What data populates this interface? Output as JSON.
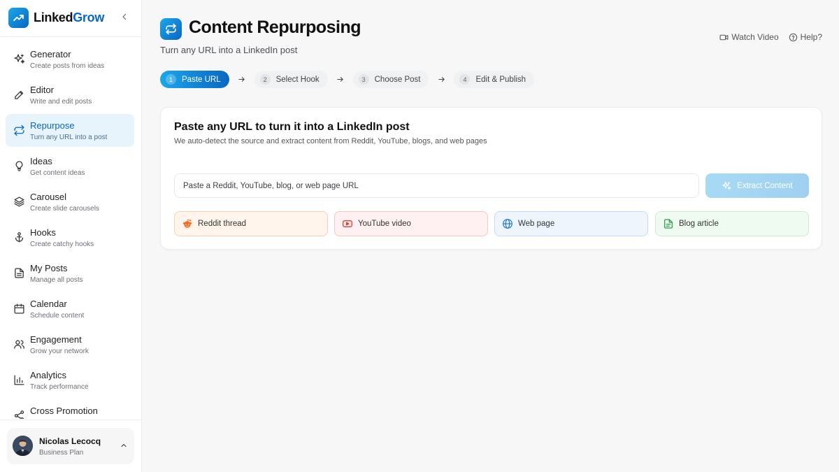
{
  "brand": {
    "name_part1": "Linked",
    "name_part2": "Grow",
    "logo_icon": "trending-up-icon"
  },
  "sidebar": {
    "items": [
      {
        "label": "Generator",
        "sub": "Create posts from ideas",
        "icon": "sparkles-icon",
        "active": false
      },
      {
        "label": "Editor",
        "sub": "Write and edit posts",
        "icon": "pencil-icon",
        "active": false
      },
      {
        "label": "Repurpose",
        "sub": "Turn any URL into a post",
        "icon": "repeat-icon",
        "active": true
      },
      {
        "label": "Ideas",
        "sub": "Get content ideas",
        "icon": "lightbulb-icon",
        "active": false
      },
      {
        "label": "Carousel",
        "sub": "Create slide carousels",
        "icon": "layers-icon",
        "active": false
      },
      {
        "label": "Hooks",
        "sub": "Create catchy hooks",
        "icon": "anchor-icon",
        "active": false
      },
      {
        "label": "My Posts",
        "sub": "Manage all posts",
        "icon": "file-text-icon",
        "active": false
      },
      {
        "label": "Calendar",
        "sub": "Schedule content",
        "icon": "calendar-icon",
        "active": false
      },
      {
        "label": "Engagement",
        "sub": "Grow your network",
        "icon": "users-icon",
        "active": false
      },
      {
        "label": "Analytics",
        "sub": "Track performance",
        "icon": "bar-chart-icon",
        "active": false
      },
      {
        "label": "Cross Promotion",
        "sub": "",
        "icon": "share-icon",
        "active": false
      }
    ]
  },
  "user": {
    "name": "Nicolas Lecocq",
    "plan": "Business Plan"
  },
  "page": {
    "title": "Content Repurposing",
    "subtitle": "Turn any URL into a LinkedIn post"
  },
  "top_actions": {
    "watch_video": "Watch Video",
    "help": "Help?"
  },
  "steps": [
    {
      "num": "1",
      "label": "Paste URL",
      "active": true
    },
    {
      "num": "2",
      "label": "Select Hook",
      "active": false
    },
    {
      "num": "3",
      "label": "Choose Post",
      "active": false
    },
    {
      "num": "4",
      "label": "Edit & Publish",
      "active": false
    }
  ],
  "card": {
    "title": "Paste any URL to turn it into a LinkedIn post",
    "description": "We auto-detect the source and extract content from Reddit, YouTube, blogs, and web pages",
    "input_placeholder": "Paste a Reddit, YouTube, blog, or web page URL",
    "input_value": "",
    "extract_label": "Extract Content",
    "sources": [
      {
        "label": "Reddit thread",
        "icon": "reddit-icon",
        "color": "#ff6314"
      },
      {
        "label": "YouTube video",
        "icon": "youtube-icon",
        "color": "#e53935"
      },
      {
        "label": "Web page",
        "icon": "globe-icon",
        "color": "#1e78d2"
      },
      {
        "label": "Blog article",
        "icon": "document-icon",
        "color": "#2e9b4a"
      }
    ]
  },
  "colors": {
    "accent": "#0a66c2",
    "accent_light": "#1aa7ec",
    "active_bg": "#e8f4fb"
  }
}
